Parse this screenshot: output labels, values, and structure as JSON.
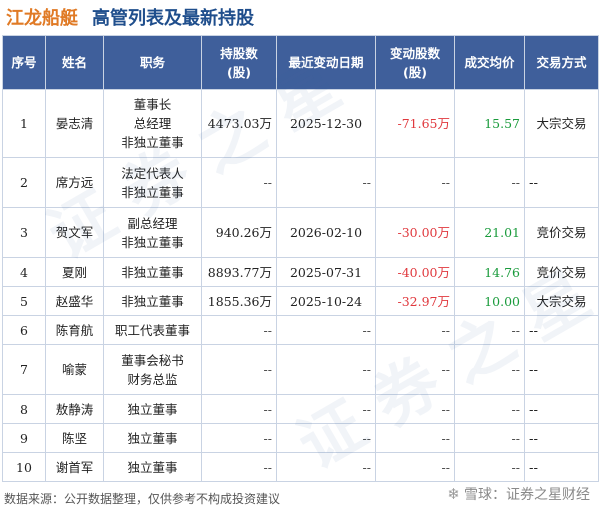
{
  "header": {
    "company": "江龙船艇",
    "title": "高管列表及最新持股"
  },
  "table": {
    "columns": [
      "序号",
      "姓名",
      "职务",
      "持股数\n(股)",
      "最近变动日期",
      "变动股数\n(股)",
      "成交均价",
      "交易方式"
    ],
    "rows": [
      {
        "no": "1",
        "name": "晏志清",
        "positions": [
          "董事长",
          "总经理",
          "非独立董事"
        ],
        "shares": "4473.03万",
        "date": "2025-12-30",
        "change": "-71.65万",
        "price": "15.57",
        "method": "大宗交易"
      },
      {
        "no": "2",
        "name": "席方远",
        "positions": [
          "法定代表人",
          "非独立董事"
        ],
        "shares": "--",
        "date": "--",
        "change": "--",
        "price": "--",
        "method": "--"
      },
      {
        "no": "3",
        "name": "贺文军",
        "positions": [
          "副总经理",
          "非独立董事"
        ],
        "shares": "940.26万",
        "date": "2026-02-10",
        "change": "-30.00万",
        "price": "21.01",
        "method": "竞价交易"
      },
      {
        "no": "4",
        "name": "夏刚",
        "positions": [
          "非独立董事"
        ],
        "shares": "8893.77万",
        "date": "2025-07-31",
        "change": "-40.00万",
        "price": "14.76",
        "method": "竞价交易"
      },
      {
        "no": "5",
        "name": "赵盛华",
        "positions": [
          "非独立董事"
        ],
        "shares": "1855.36万",
        "date": "2025-10-24",
        "change": "-32.97万",
        "price": "10.00",
        "method": "大宗交易"
      },
      {
        "no": "6",
        "name": "陈育航",
        "positions": [
          "职工代表董事"
        ],
        "shares": "--",
        "date": "--",
        "change": "--",
        "price": "--",
        "method": "--"
      },
      {
        "no": "7",
        "name": "喻蒙",
        "positions": [
          "董事会秘书",
          "财务总监"
        ],
        "shares": "--",
        "date": "--",
        "change": "--",
        "price": "--",
        "method": "--"
      },
      {
        "no": "8",
        "name": "敖静涛",
        "positions": [
          "独立董事"
        ],
        "shares": "--",
        "date": "--",
        "change": "--",
        "price": "--",
        "method": "--"
      },
      {
        "no": "9",
        "name": "陈坚",
        "positions": [
          "独立董事"
        ],
        "shares": "--",
        "date": "--",
        "change": "--",
        "price": "--",
        "method": "--"
      },
      {
        "no": "10",
        "name": "谢首军",
        "positions": [
          "独立董事"
        ],
        "shares": "--",
        "date": "--",
        "change": "--",
        "price": "--",
        "method": "--"
      }
    ]
  },
  "footer": {
    "source": "数据来源：公开数据整理，仅供参考不构成投资建议"
  },
  "brand": {
    "text": "雪球：证券之星财经"
  },
  "colors": {
    "header_bg": "#3f5f9b",
    "negative": "#e0393e",
    "positive": "#1a9b3c",
    "company": "#e07a25",
    "title": "#1f4e8c"
  }
}
